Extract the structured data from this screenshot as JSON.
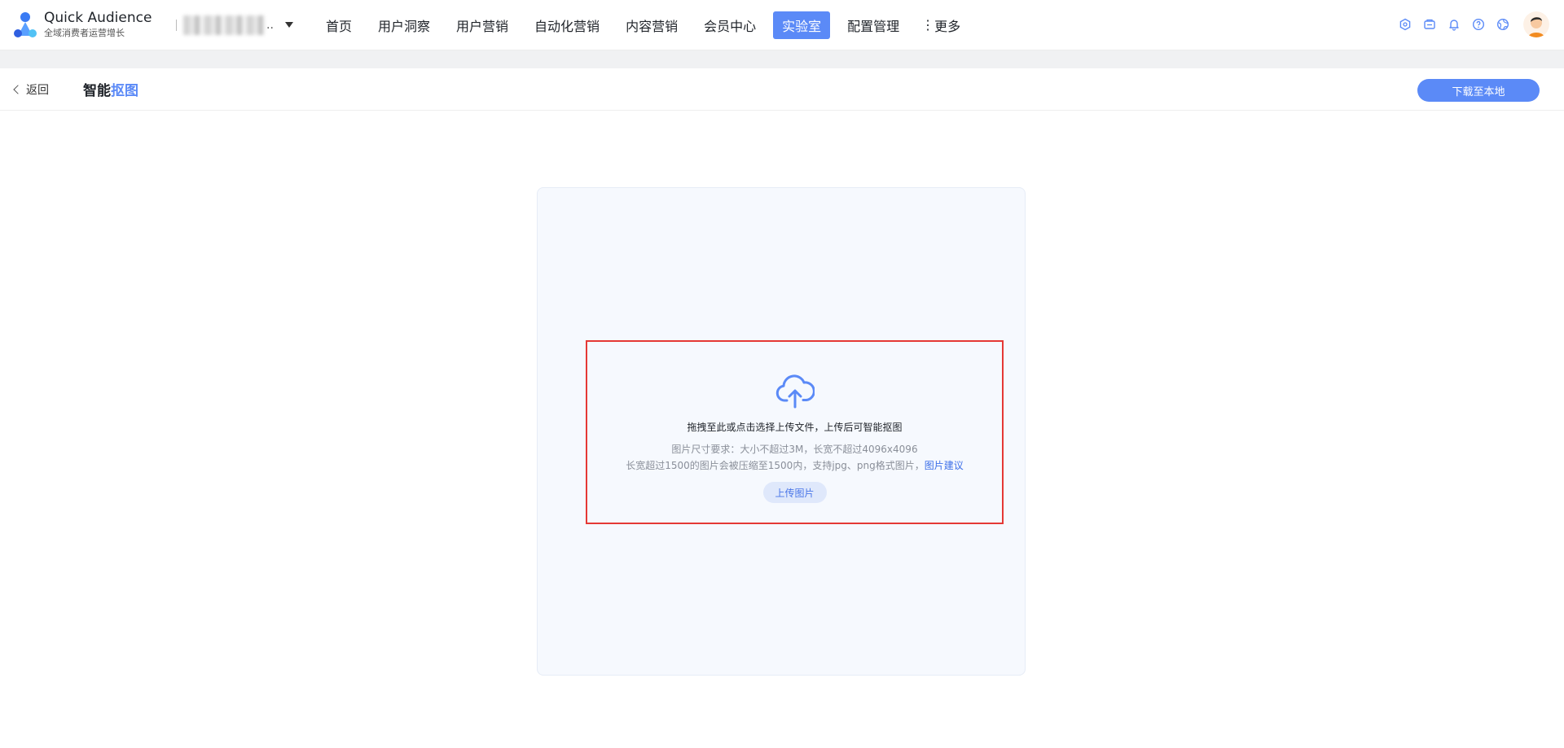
{
  "brand": {
    "name": "Quick Audience",
    "subtitle": "全域消费者运营增长"
  },
  "workspace": {
    "name_masked": "..",
    "caret_icon": "caret-down-icon"
  },
  "nav": {
    "items": [
      {
        "label": "首页"
      },
      {
        "label": "用户洞察"
      },
      {
        "label": "用户营销"
      },
      {
        "label": "自动化营销"
      },
      {
        "label": "内容营销"
      },
      {
        "label": "会员中心"
      },
      {
        "label": "实验室",
        "active": true
      },
      {
        "label": "配置管理"
      }
    ],
    "more_label": "更多"
  },
  "top_icons": [
    "app-store-icon",
    "message-box-icon",
    "bell-icon",
    "help-icon",
    "globe-icon",
    "avatar"
  ],
  "header": {
    "back_label": "返回",
    "title_part1": "智能",
    "title_part2": "抠图",
    "download_label": "下载至本地"
  },
  "upload": {
    "main_text": "拖拽至此或点击选择上传文件，上传后可智能抠图",
    "requirement_line1": "图片尺寸要求：大小不超过3M，长宽不超过4096x4096",
    "requirement_line2": "长宽超过1500的图片会被压缩至1500内，支持jpg、png格式图片，",
    "suggest_link": "图片建议",
    "button_label": "上传图片",
    "icon": "cloud-upload-icon"
  },
  "colors": {
    "accent": "#5b8af7",
    "highlight_border": "#e53935",
    "card_bg": "#f6f9fe"
  }
}
